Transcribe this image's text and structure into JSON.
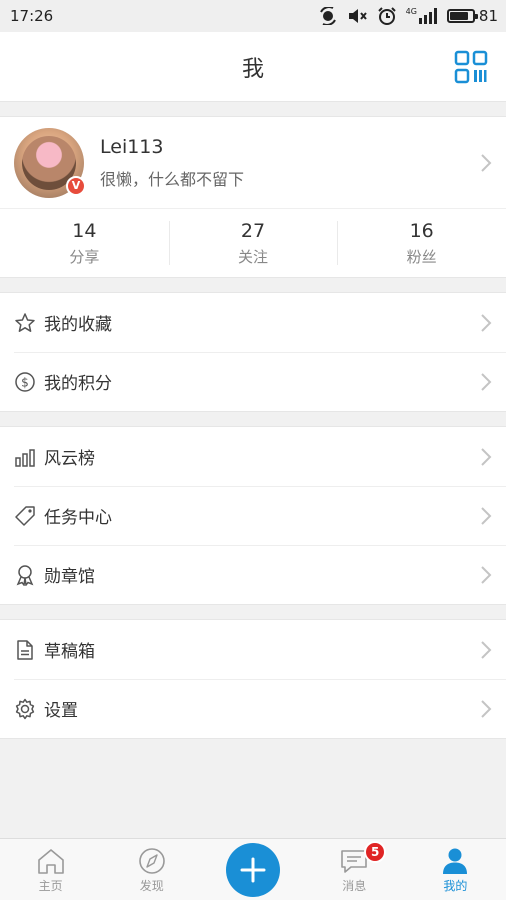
{
  "status_bar": {
    "time": "17:26",
    "network_label": "4G",
    "battery": "81",
    "battery_level": 0.81
  },
  "header": {
    "title": "我",
    "qr_icon": "qr-code-icon"
  },
  "profile": {
    "username": "Lei113",
    "signature": "很懒，什么都不留下",
    "verified_badge": "V",
    "stats": [
      {
        "value": "14",
        "label": "分享"
      },
      {
        "value": "27",
        "label": "关注"
      },
      {
        "value": "16",
        "label": "粉丝"
      }
    ]
  },
  "menu": {
    "favorites": "我的收藏",
    "points": "我的积分",
    "ranking": "风云榜",
    "tasks": "任务中心",
    "medals": "勋章馆",
    "drafts": "草稿箱",
    "settings": "设置"
  },
  "tabbar": {
    "home": "主页",
    "discover": "发现",
    "messages": "消息",
    "messages_badge": "5",
    "me": "我的"
  },
  "colors": {
    "accent": "#1a8fd6",
    "badge": "#e02525",
    "background": "#f1f1f1"
  }
}
